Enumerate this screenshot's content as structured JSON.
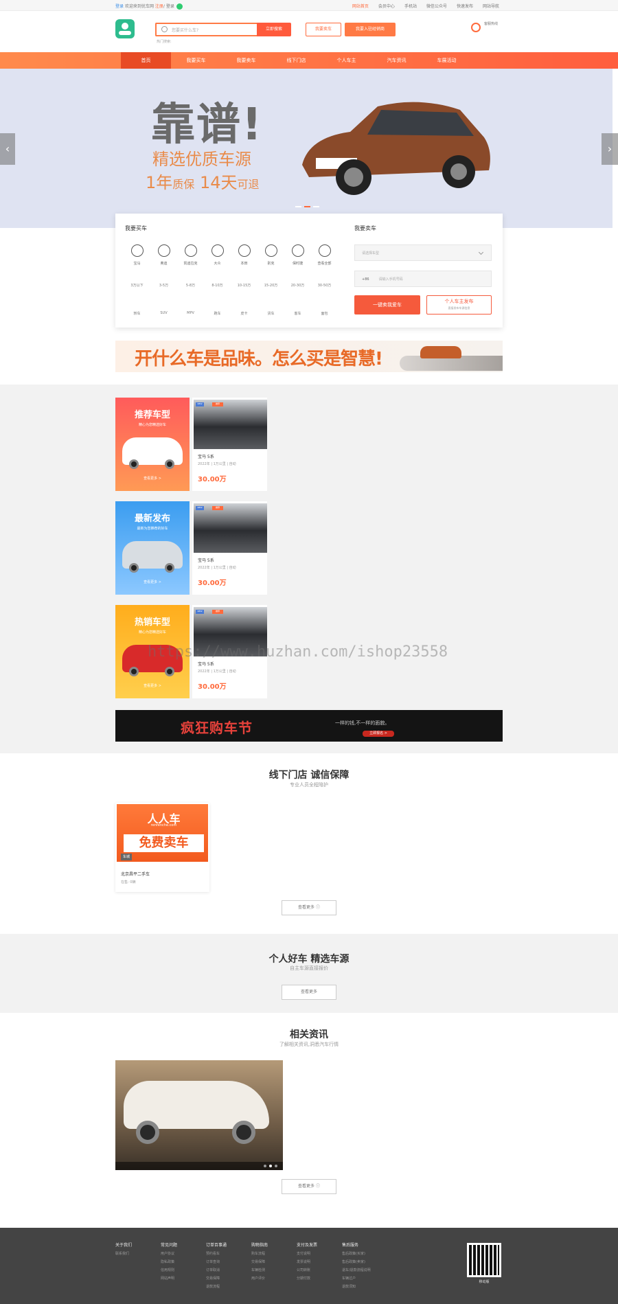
{
  "topbar": {
    "login": "登录",
    "hello": "欢迎来到优车网",
    "register": "注册",
    "tail": "/ 登录",
    "links": [
      "网站首页",
      "会员中心",
      "手机站",
      "微信公众号",
      "快速发布",
      "网站导航"
    ]
  },
  "search": {
    "placeholder": "您要买什么车?",
    "button": "立即搜索",
    "hot": "热门搜索:"
  },
  "header": {
    "buy_btn": "我要卖车",
    "join_btn": "我要入驻经销商",
    "phone_label": "客服热线"
  },
  "nav": [
    "首页",
    "我要买车",
    "我要卖车",
    "线下门店",
    "个人车主",
    "汽车资讯",
    "车展活动"
  ],
  "banner": {
    "title": "靠谱!",
    "subtitle": "精选优质车源",
    "line_a": "1年",
    "line_b": "质保",
    "line_c": "14天",
    "line_d": "可退"
  },
  "buy_panel": {
    "title": "我要买车",
    "brands": [
      "宝马",
      "奥迪",
      "凯迪拉克",
      "大众",
      "本田",
      "别克",
      "保时捷",
      "查看全部"
    ],
    "prices": [
      "3万以下",
      "3-5万",
      "5-8万",
      "8-10万",
      "10-15万",
      "15-20万",
      "20-30万",
      "30-50万"
    ],
    "types": [
      "轿车",
      "SUV",
      "MPV",
      "跑车",
      "皮卡",
      "货车",
      "客车",
      "面包"
    ]
  },
  "sell_panel": {
    "title": "我要卖车",
    "select": "请选择车型",
    "code": "+86",
    "phone_ph": "请输入手机号码",
    "btn_a": "一键卖我爱车",
    "btn_b": "个人车主发布",
    "btn_b_sub": "直接发布车源信息"
  },
  "ad1": {
    "text": "开什么车是品味。怎么买是智慧!"
  },
  "categories": [
    {
      "title": "推荐车型",
      "sub": "精心为您精选好车",
      "more": "查看更多 >"
    },
    {
      "title": "最新发布",
      "sub": "最新为您推荐的好车",
      "more": "查看更多 >"
    },
    {
      "title": "热销车型",
      "sub": "精心为您精选好车",
      "more": "查看更多 >"
    }
  ],
  "cards": [
    {
      "new": "NEW",
      "tag": "推荐",
      "name": "宝马 5系",
      "meta": "2022年 | 1万公里 | 自动",
      "price": "30.00万"
    },
    {
      "new": "NEW",
      "tag": "推荐",
      "name": "宝马 5系",
      "meta": "2022年 | 1万公里 | 自动",
      "price": "30.00万"
    },
    {
      "new": "NEW",
      "tag": "推荐",
      "name": "宝马 5系",
      "meta": "2022年 | 1万公里 | 自动",
      "price": "30.00万"
    }
  ],
  "ad2": {
    "title": "疯狂购车节",
    "slogan": "一样的钱,不一样的面貌。",
    "btn": "立即报名 >"
  },
  "stores": {
    "title": "线下门店 诚信保障",
    "sub": "专业人员全程陪护",
    "logo": "人人车",
    "logo_sub": "renrenche.com",
    "banner": "免费卖车",
    "label": "车城",
    "name": "北京昌平二手车",
    "stock": "在售: 0辆",
    "more": "查看更多"
  },
  "owners": {
    "title": "个人好车 精选车源",
    "sub": "自主车源直接报价",
    "more": "查看更多"
  },
  "news": {
    "title": "相关资讯",
    "sub": "了解相关资讯,洞悉汽车行情",
    "more": "查看更多"
  },
  "watermark": "https://www.huzhan.com/ishop23558",
  "footer": {
    "cols": [
      {
        "h": "关于我们",
        "items": [
          "联系我们"
        ]
      },
      {
        "h": "常见问题",
        "items": [
          "用户协议",
          "隐私政策",
          "信用规则",
          "网站声明"
        ]
      },
      {
        "h": "订单百事通",
        "items": [
          "预约看车",
          "订单查询",
          "订单取消",
          "交易保障",
          "退款流程"
        ]
      },
      {
        "h": "购物指南",
        "items": [
          "购车流程",
          "交易保障",
          "车辆检测",
          "用户评价"
        ]
      },
      {
        "h": "支付及发票",
        "items": [
          "支付说明",
          "发票说明",
          "公司转账",
          "分期付款"
        ]
      },
      {
        "h": "售后服务",
        "items": [
          "售后政策(买家)",
          "售后政策(卖家)",
          "退车/退款流程说明",
          "车辆过户",
          "退款须知"
        ]
      }
    ],
    "qr_label": "移动版"
  }
}
